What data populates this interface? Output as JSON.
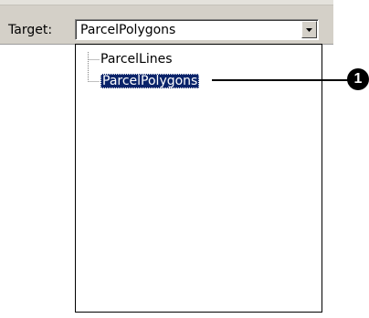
{
  "toolbar": {
    "target_label": "Target:",
    "combo_value": "ParcelPolygons",
    "combo_button_icon": "chevron-down-icon"
  },
  "dropdown": {
    "items": [
      {
        "label": "ParcelLines",
        "selected": false
      },
      {
        "label": "ParcelPolygons",
        "selected": true
      }
    ]
  },
  "callout": {
    "number": "1"
  },
  "colors": {
    "toolbar": "#d4d0c8",
    "selection": "#0a246a",
    "callout": "#000000"
  }
}
